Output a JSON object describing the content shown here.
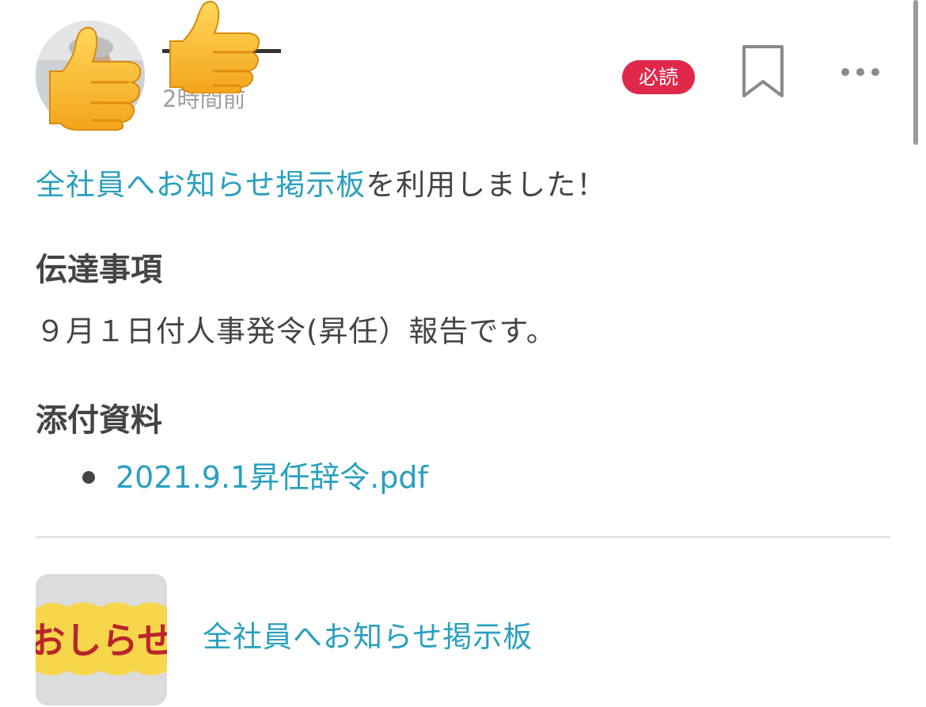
{
  "post": {
    "author_name": "",
    "timestamp": "2時間前",
    "badge": "必読",
    "activity": {
      "board_link": "全社員へお知らせ掲示板",
      "suffix": "を利用しました！"
    }
  },
  "content": {
    "heading1": "伝達事項",
    "body": "９月１日付人事発令(昇任）報告です。",
    "heading2": "添付資料",
    "attachments": [
      "2021.9.1昇任辞令.pdf"
    ]
  },
  "board": {
    "thumb_text": "おしらせ",
    "name": "全社員へお知らせ掲示板"
  },
  "icons": {
    "bookmark": "bookmark-icon",
    "more": "more-dots-icon",
    "overlay": "thumbs-up-emoji"
  },
  "colors": {
    "link": "#2aa0bf",
    "badge": "#e0284a",
    "text": "#444444",
    "muted": "#a0a0a0"
  }
}
